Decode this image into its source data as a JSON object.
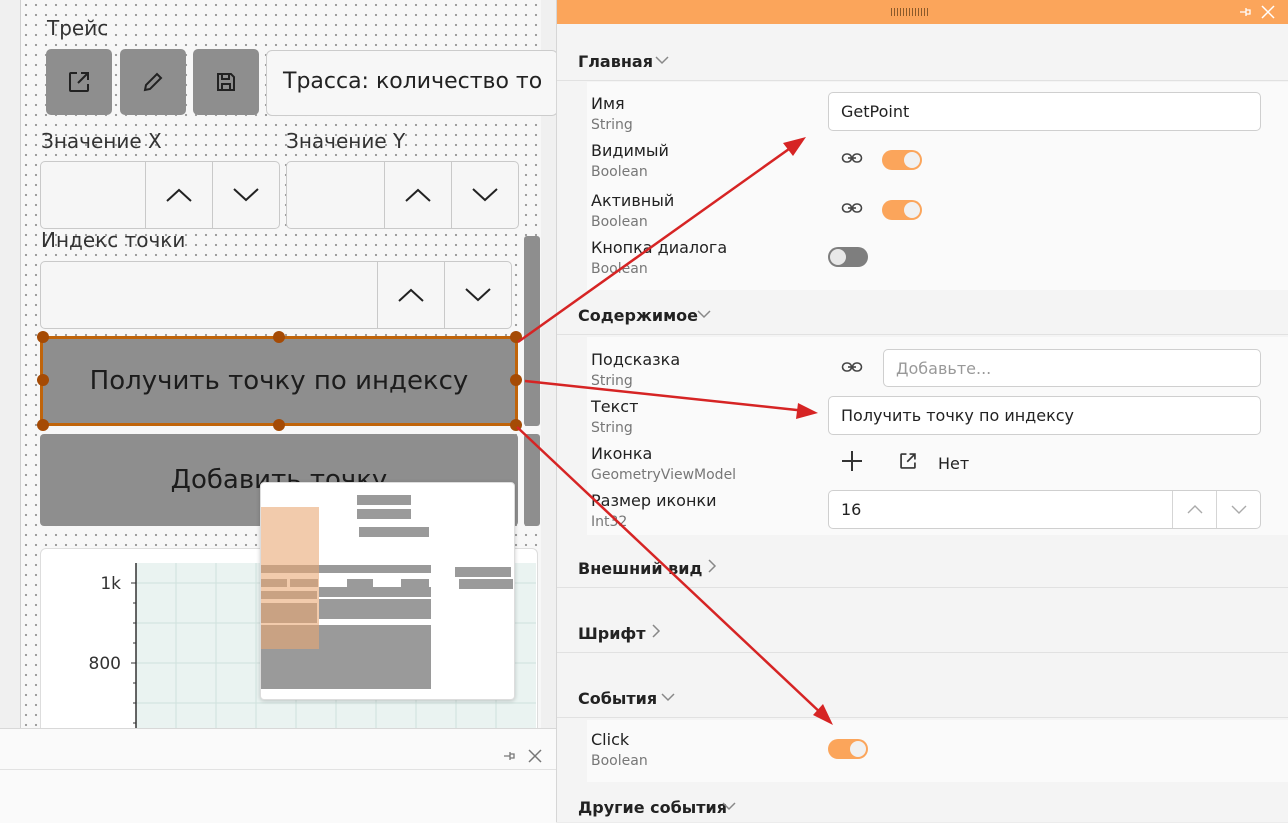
{
  "designer": {
    "trace_label": "Трейс",
    "trace_field_value": "Трасса: количество то",
    "value_x_label": "Значение X",
    "value_y_label": "Значение Y",
    "point_index_label": "Индекс точки",
    "get_point_button": "Получить точку по индексу",
    "add_point_button": "Добавить точку",
    "chart": {
      "y_ticks": [
        "1k",
        "800"
      ]
    }
  },
  "properties": {
    "sections": {
      "main": "Главная",
      "content": "Содержимое",
      "appearance": "Внешний вид",
      "font": "Шрифт",
      "events": "События",
      "other_events": "Другие события"
    },
    "rows": {
      "name": {
        "label": "Имя",
        "type": "String",
        "value": "GetPoint"
      },
      "visible": {
        "label": "Видимый",
        "type": "Boolean",
        "on": true
      },
      "active": {
        "label": "Активный",
        "type": "Boolean",
        "on": true
      },
      "dialog_button": {
        "label": "Кнопка диалога",
        "type": "Boolean",
        "on": false
      },
      "tooltip": {
        "label": "Подсказка",
        "type": "String",
        "placeholder": "Добавьте..."
      },
      "text": {
        "label": "Текст",
        "type": "String",
        "value": "Получить точку по индексу"
      },
      "icon": {
        "label": "Иконка",
        "type": "GeometryViewModel",
        "value": "Нет"
      },
      "icon_size": {
        "label": "Размер иконки",
        "type": "Int32",
        "value": "16"
      },
      "click": {
        "label": "Click",
        "type": "Boolean",
        "on": true
      }
    }
  },
  "colors": {
    "accent": "#fba55b",
    "selection": "#a54b05",
    "arrow": "#d62424",
    "button": "#8e8e8e"
  }
}
